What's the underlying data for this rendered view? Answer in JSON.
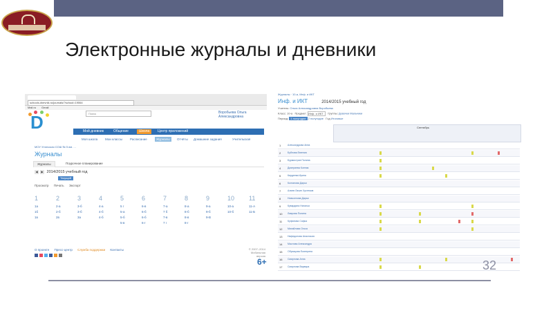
{
  "slide": {
    "title": "Электронные журналы и дневники",
    "page_number": "32"
  },
  "left": {
    "url": "schools.dnevnik.ru/journals/?school=19064",
    "bookmark_items": [
      "Mail.ru",
      "Gmail"
    ],
    "search_placeholder": "Поиск",
    "user_name": "Воробьева Ольга Александровна",
    "nav": [
      "Мой дневник",
      "Общение",
      "Школа",
      "Центр приложений"
    ],
    "nav_active": 2,
    "subnav": [
      "Моя школа",
      "Мои классы",
      "Расписание",
      "Журналы",
      "Отчёты",
      "Домашние задания",
      "Учительская"
    ],
    "subnav_active": 3,
    "breadcrumb": "МОУ Угличская СОШ № 5 им. ... ",
    "heading": "Журналы",
    "tabs": [
      "Журналы",
      "Поурочное планирование"
    ],
    "year": "2014/2015 учебный год",
    "current_week_btn": "Текущий год",
    "tools": [
      "Просмотр",
      "Печать",
      "Экспорт"
    ],
    "grades": [
      {
        "num": "1",
        "classes": [
          "1а",
          "1б",
          "1в"
        ]
      },
      {
        "num": "2",
        "classes": [
          "2-а",
          "2-б",
          "2в"
        ]
      },
      {
        "num": "3",
        "classes": [
          "3-б",
          "3-б",
          "3а"
        ]
      },
      {
        "num": "4",
        "classes": [
          "4-а",
          "4-б",
          "4-б"
        ]
      },
      {
        "num": "5",
        "classes": [
          "5 г",
          "5-а",
          "5-б",
          "5-в"
        ]
      },
      {
        "num": "6",
        "classes": [
          "6-в",
          "6-б",
          "6-б",
          "6-г"
        ]
      },
      {
        "num": "7",
        "classes": [
          "7-а",
          "7 б",
          "7-в",
          "7 г"
        ]
      },
      {
        "num": "8",
        "classes": [
          "8-а",
          "8-б",
          "8-в",
          "8-г"
        ]
      },
      {
        "num": "9",
        "classes": [
          "9-а",
          "9-б",
          "9-В"
        ]
      },
      {
        "num": "10",
        "classes": [
          "10-а",
          "10-б"
        ]
      },
      {
        "num": "11",
        "classes": [
          "11-А",
          "11-Б"
        ]
      }
    ],
    "footer_links": [
      "О проекте",
      "Пресс-центр",
      "Служба поддержки",
      "Контакты"
    ],
    "footer_orange_index": 2,
    "footer_right": [
      "© 2007–2014",
      "Мобильная версия"
    ],
    "footer_badge": "6+"
  },
  "right": {
    "breadcrumb": "Журналы · 10-а, Инф. и ИКТ",
    "heading": "Инф. и ИКТ",
    "year": "2014/2015 учебный год",
    "teacher_label": "Учитель:",
    "teacher": "Ольга Александровна Воробьева",
    "class_label": "Класс:",
    "class_value": "10-а",
    "subject_label": "Предмет:",
    "subject_value": "Инф. и ИКТ",
    "groups_label": "Группы:",
    "groups": [
      "Девочки",
      "Мальчики"
    ],
    "period_label": "Период:",
    "periods": [
      "1 полугодие",
      "2 полугодие"
    ],
    "period_extra": [
      "Год",
      "Итоговые"
    ],
    "month": "Сентябрь",
    "students": [
      "Александрова Анна",
      "Бубнова Евгения",
      "Бурмистров Полина",
      "Дмитриева Ксения",
      "Кирдеева Ирина",
      "Колганова Дарья",
      "Алиев Лачин Хустемов",
      "Новоселова Дарья",
      "Кувардина Наталья",
      "Лаврова Полина",
      "Куфанова Софья",
      "Михайлова Ольга",
      "Нафедонова Анастасия",
      "Маслова Александра",
      "Образцова Екатерина",
      "Смирнова Анна",
      "Смирнова Варвара",
      "Смирнова Ангелина"
    ]
  },
  "colors": {
    "topbar": "#5b6383",
    "brand_blue": "#2d6eb3",
    "accent_orange": "#f29a2e",
    "mark_yellow": "#d9d94a",
    "mark_red": "#e26a6a",
    "mark_green": "#7dcf6a"
  }
}
